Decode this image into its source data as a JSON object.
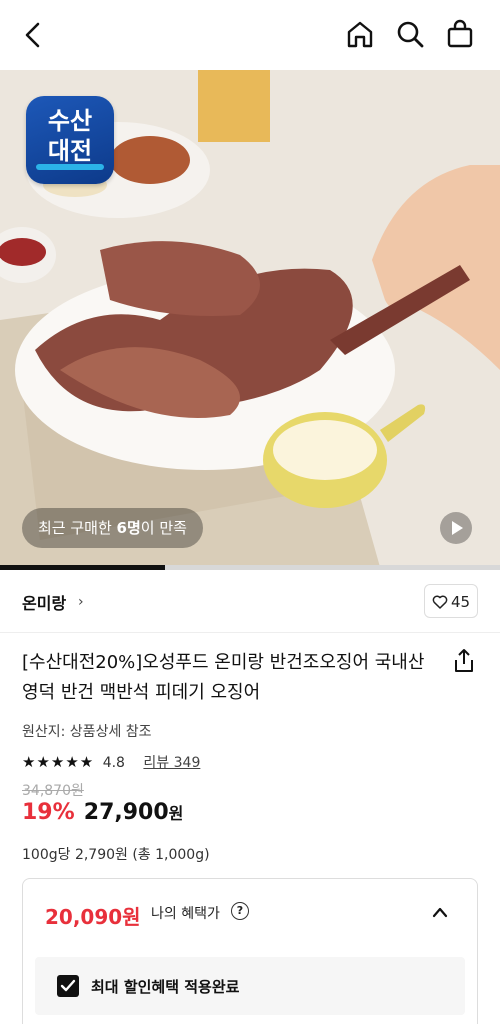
{
  "header": {
    "back_icon": "chevron-left-icon",
    "home_icon": "home-icon",
    "search_icon": "search-icon",
    "cart_icon": "shopping-bag-icon"
  },
  "hero": {
    "logo_line1": "수산",
    "logo_line2": "대전",
    "buyer_prefix": "최근 구매한 ",
    "buyer_count": "6명",
    "buyer_suffix": "이 만족",
    "play_icon": "play-icon",
    "carousel_progress": 0.33
  },
  "seller": {
    "name": "온미랑",
    "chevron": "›",
    "like_count": "45",
    "like_icon": "heart-icon"
  },
  "product": {
    "title": "[수산대전20%]오성푸드 온미랑 반건조오징어 국내산 영덕 반건 맥반석 피데기 오징어",
    "share_icon": "share-icon",
    "origin": "원산지: 상품상세 참조",
    "stars": "★★★★★",
    "rating": "4.8",
    "reviews": "리뷰 349",
    "original_price": "34,870원",
    "discount": "19%",
    "price": "27,900",
    "price_unit": "원",
    "unit_price": "100g당 2,790원 (총 1,000g)"
  },
  "benefit": {
    "price": "20,090원",
    "label": "나의 혜택가",
    "help_glyph": "?",
    "applied_label": "최대 할인혜택 적용완료",
    "applied_checked": true
  },
  "colors": {
    "sale_red": "#e8303b",
    "brand_blue": "#1d58b8"
  }
}
